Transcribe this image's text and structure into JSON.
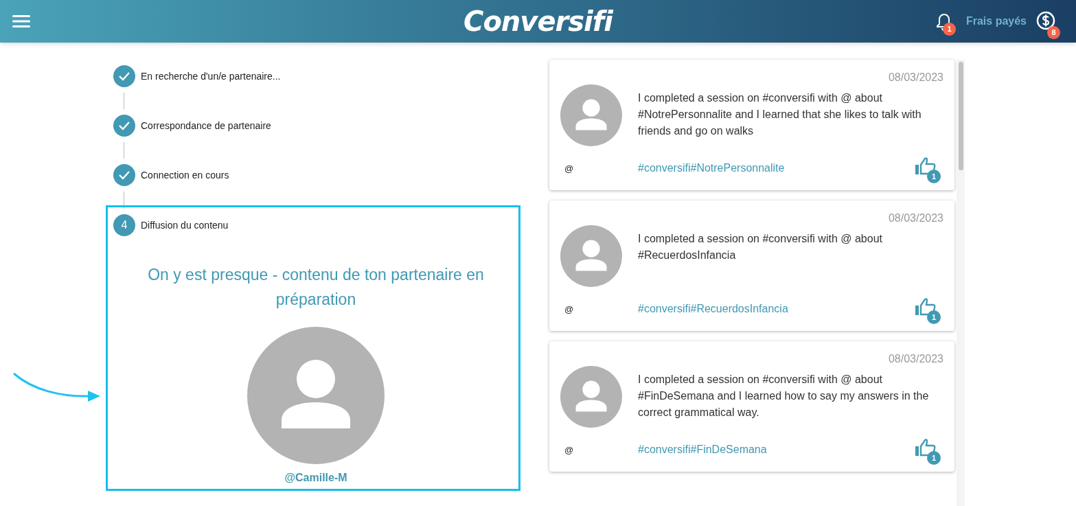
{
  "header": {
    "logo": "Conversifi",
    "notifications_badge": "1",
    "fees_label": "Frais payés",
    "fees_badge": "8"
  },
  "steps": [
    {
      "label": "En recherche d'un/e partenaire...",
      "completed": true
    },
    {
      "label": "Correspondance de partenaire",
      "completed": true
    },
    {
      "label": "Connection en cours",
      "completed": true
    },
    {
      "label": "Diffusion du contenu",
      "completed": false,
      "number": "4"
    }
  ],
  "current_step": {
    "message": "On y est presque - contenu de ton partenaire en préparation",
    "username": "@Camille-M",
    "highlighted": true
  },
  "feed": [
    {
      "date": "08/03/2023",
      "text": "I completed a session on #conversifi with @ about #NotrePersonnalite and I learned that she likes to talk with friends and go on walks",
      "user": "@",
      "tags": "#conversifi#NotrePersonnalite",
      "likes": "1"
    },
    {
      "date": "08/03/2023",
      "text": "I completed a session on #conversifi with @ about #RecuerdosInfancia",
      "user": "@",
      "tags": "#conversifi#RecuerdosInfancia",
      "likes": "1"
    },
    {
      "date": "08/03/2023",
      "text": "I completed a session on #conversifi with @ about #FinDeSemana and I learned how to say my answers in the correct grammatical way.",
      "user": "@",
      "tags": "#conversifi#FinDeSemana",
      "likes": "1"
    }
  ]
}
